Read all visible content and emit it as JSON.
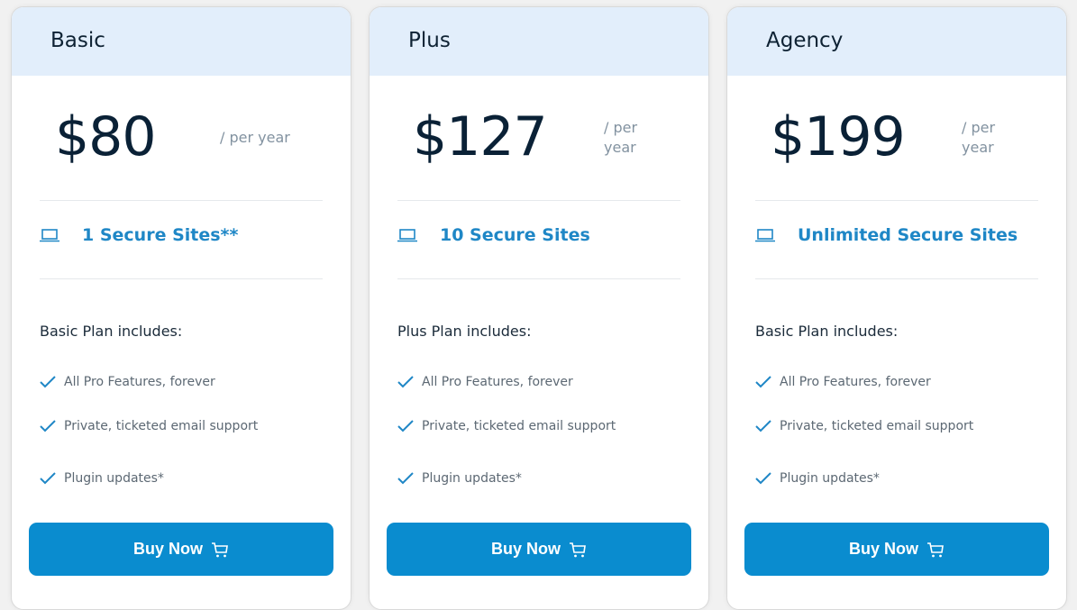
{
  "colors": {
    "header_bg": "#e2eefb",
    "accent": "#1f87c6",
    "button_bg": "#0a8ccf",
    "price_text": "#0a2136"
  },
  "plans": [
    {
      "name": "Basic",
      "price": "$80",
      "period_line1": "/ per year",
      "period_line2": "",
      "sites_icon": "laptop-icon",
      "sites_label": "1 Secure Sites**",
      "includes_label": "Basic Plan includes:",
      "features": [
        "All Pro Features, forever",
        "Private, ticketed email support",
        "Plugin updates*"
      ],
      "feature_icon": "check-icon",
      "button_label": "Buy Now",
      "button_icon": "cart-icon"
    },
    {
      "name": "Plus",
      "price": "$127",
      "period_line1": "/ per",
      "period_line2": "year",
      "sites_icon": "laptop-icon",
      "sites_label": "10 Secure Sites",
      "includes_label": "Plus Plan includes:",
      "features": [
        "All Pro Features, forever",
        "Private, ticketed email support",
        "Plugin updates*"
      ],
      "feature_icon": "check-icon",
      "button_label": "Buy Now",
      "button_icon": "cart-icon"
    },
    {
      "name": "Agency",
      "price": "$199",
      "period_line1": "/ per",
      "period_line2": "year",
      "sites_icon": "laptop-icon",
      "sites_label": "Unlimited Secure Sites",
      "includes_label": "Basic Plan includes:",
      "features": [
        "All Pro Features, forever",
        "Private, ticketed email support",
        "Plugin updates*"
      ],
      "feature_icon": "check-icon",
      "button_label": "Buy Now",
      "button_icon": "cart-icon"
    }
  ]
}
